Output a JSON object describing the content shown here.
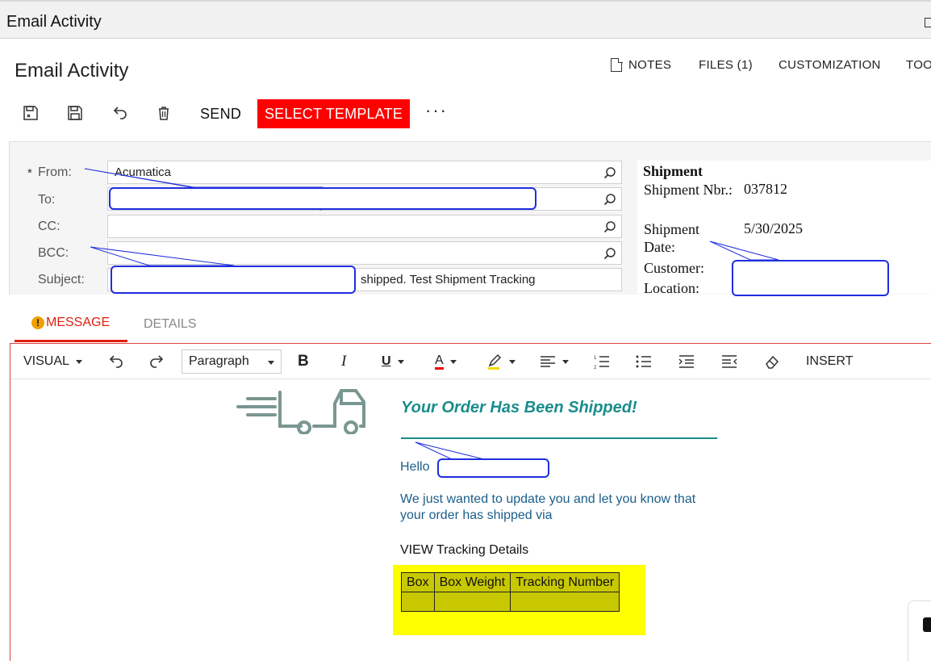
{
  "window": {
    "title": "Email Activity"
  },
  "page": {
    "title": "Email Activity"
  },
  "header_links": [
    {
      "label": "NOTES"
    },
    {
      "label": "FILES (1)"
    },
    {
      "label": "CUSTOMIZATION"
    },
    {
      "label": "TOO"
    }
  ],
  "toolbar": {
    "send_label": "SEND",
    "select_template_label": "SELECT TEMPLATE",
    "more_label": "···"
  },
  "form": {
    "required_mark": "*",
    "from_label": "From:",
    "from_value": "Acumatica",
    "to_label": "To:",
    "cc_label": "CC:",
    "bcc_label": "BCC:",
    "subject_label": "Subject:",
    "subject_value": "shipped. Test Shipment Tracking"
  },
  "shipment": {
    "title": "Shipment",
    "nbr_label": "Shipment Nbr.:",
    "nbr_value": "037812",
    "date_label": "Shipment Date:",
    "date_value": "5/30/2025",
    "customer_label": "Customer:",
    "location_label": "Location:"
  },
  "tabs": {
    "message": "MESSAGE",
    "details": "DETAILS",
    "warning_glyph": "!"
  },
  "editor_toolbar": {
    "mode": "VISUAL",
    "paragraph": "Paragraph",
    "bold": "B",
    "italic": "I",
    "underline": "U",
    "font_color": "A",
    "insert": "INSERT"
  },
  "email_body": {
    "headline": "Your Order Has Been Shipped!",
    "hello": "Hello",
    "text": "We just wanted to update you and let you know that your order  has shipped via",
    "view_tracking": "VIEW Tracking Details",
    "table_headers": [
      "Box",
      "Box Weight",
      "Tracking Number"
    ],
    "table_row": [
      "",
      "",
      ""
    ]
  },
  "colors": {
    "accent_red": "#ff0000",
    "tab_red": "#dd2211",
    "teal": "#1a8c8c",
    "body_blue": "#1a5e8a",
    "highlight_yellow": "#ffff00",
    "redaction_border": "#1f2ee0"
  }
}
